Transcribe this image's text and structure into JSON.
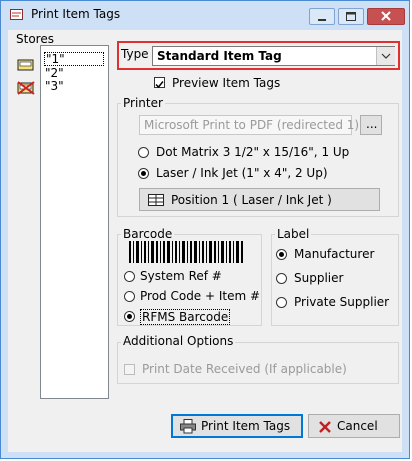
{
  "window": {
    "title": "Print Item Tags"
  },
  "stores": {
    "group_label": "Stores",
    "items": [
      "\"1\"",
      "\"2\"",
      "\"3\""
    ]
  },
  "type": {
    "label": "Type",
    "selected": "Standard Item Tag",
    "highlight_color": "#e03030"
  },
  "preview": {
    "label": "Preview Item Tags",
    "checked": true
  },
  "printer": {
    "group_label": "Printer",
    "selected_printer": "Microsoft Print to PDF (redirected 1)",
    "browse_label": "...",
    "options": [
      {
        "label": "Dot Matrix 3 1/2\" x 15/16\", 1 Up",
        "selected": false
      },
      {
        "label": "Laser / Ink Jet (1\" x 4\", 2 Up)",
        "selected": true
      }
    ],
    "position_label": "Position 1  ( Laser / Ink Jet )"
  },
  "barcode": {
    "group_label": "Barcode",
    "options": [
      {
        "label": "System Ref #",
        "selected": false
      },
      {
        "label": "Prod Code + Item #",
        "selected": false
      },
      {
        "label": "RFMS Barcode",
        "selected": true
      }
    ]
  },
  "label_group": {
    "group_label": "Label",
    "options": [
      {
        "label": "Manufacturer",
        "selected": true
      },
      {
        "label": "Supplier",
        "selected": false
      },
      {
        "label": "Private Supplier",
        "selected": false
      }
    ]
  },
  "additional": {
    "group_label": "Additional Options",
    "print_date_label": "Print Date Received (If applicable)"
  },
  "buttons": {
    "print_label": "Print Item Tags",
    "cancel_label": "Cancel"
  }
}
